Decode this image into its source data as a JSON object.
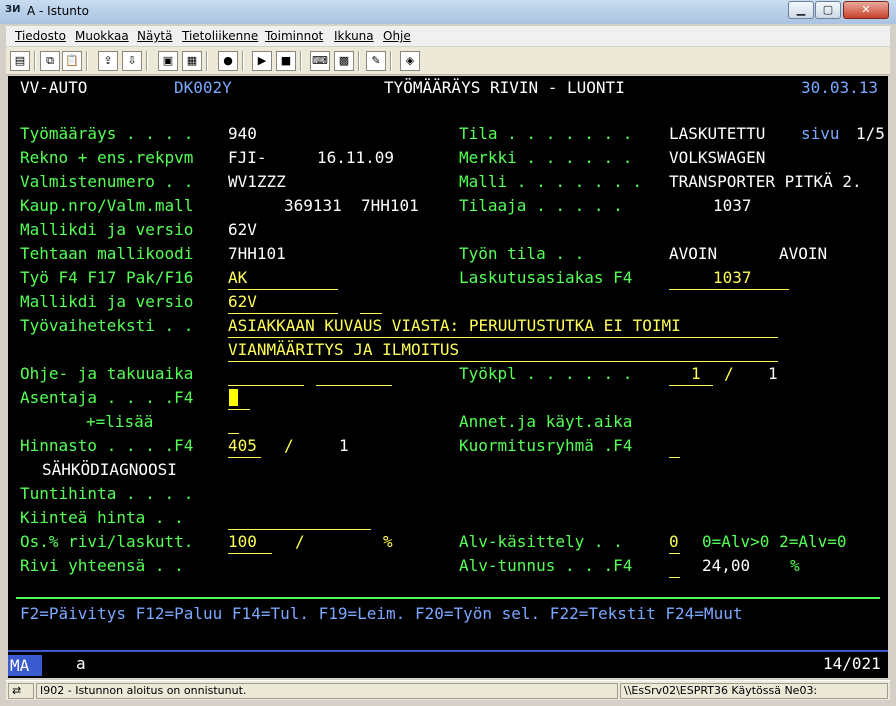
{
  "window": {
    "app_icon": "ЗИ",
    "title": "A - Istunto"
  },
  "menu": [
    "Tiedosto",
    "Muokkaa",
    "Näytä",
    "Tietoliikenne",
    "Toiminnot",
    "Ikkuna",
    "Ohje"
  ],
  "toolbar_icons": [
    "print-icon",
    "copy-icon",
    "paste-icon",
    "send-icon",
    "receive-icon",
    "display-icon",
    "macro-icon",
    "record-icon",
    "play-icon",
    "stop-icon",
    "keyboard-icon",
    "map-icon",
    "clipboard-icon",
    "eraser-icon"
  ],
  "header": {
    "company": "VV-AUTO",
    "program": "DK002Y",
    "title": "TYÖMÄÄRÄYS RIVIN - LUONTI",
    "date": "30.03.13"
  },
  "fields": {
    "tyomaarays_label": "Työmääräys . . . .",
    "tyomaarays_value": "940",
    "tila_label": "Tila . . . . . . .",
    "tila_value": "LASKUTETTU",
    "sivu_label": "sivu",
    "sivu_value": "1/5",
    "rekno_label": "Rekno + ens.rekpvm",
    "rekno_value": "FJI-",
    "rekpvm_value": "16.11.09",
    "merkki_label": "Merkki . . . . . .",
    "merkki_value": "VOLKSWAGEN",
    "valmistenumero_label": "Valmistenumero . .",
    "valmistenumero_value": "WV1ZZZ",
    "malli_label": "Malli . . . . . . .",
    "malli_value": "TRANSPORTER PITKÄ 2.",
    "kaup_label": "Kaup.nro/Valm.mall",
    "kaup_nro": "369131",
    "valm_mall": "7HH101",
    "tilaaja_label": "Tilaaja . . . . .",
    "tilaaja_value": "1037",
    "mallikdi1_label": "Mallikdi ja versio",
    "mallikdi1_value": "62V",
    "tehtaan_label": "Tehtaan mallikoodi",
    "tehtaan_value": "7HH101",
    "tyon_tila_label": "Työn tila . .",
    "tyon_tila_value1": "AVOIN",
    "tyon_tila_value2": "AVOIN",
    "tyo_f4_label": "Työ F4 F17 Pak/F16",
    "tyo_f4_value": "AK",
    "laskutusasiakas_label": "Laskutusasiakas F4",
    "laskutusasiakas_value": "1037",
    "mallikdi2_label": "Mallikdi ja versio",
    "mallikdi2_value": "62V",
    "tyovaiheteksti_label": "Työvaiheteksti . .",
    "tyovaiheteksti_line1": "ASIAKKAAN KUVAUS VIASTA: PERUUTUSTUTKA EI TOIMI",
    "tyovaiheteksti_line2": "VIANMÄÄRITYS JA ILMOITUS",
    "ohje_label": "Ohje- ja takuuaika",
    "tyokpl_label": "Työkpl . . . . . .",
    "tyokpl_value": "1",
    "tyokpl_slash": "/",
    "tyokpl_total": "1",
    "asentaja_label": "Asentaja . . . .F4",
    "lisaa_label": "+=lisää",
    "annet_label": "Annet.ja käyt.aika",
    "hinnasto_label": "Hinnasto . . . .F4",
    "hinnasto_value": "405",
    "hinnasto_slash": "/",
    "hinnasto_num": "1",
    "kuormitus_label": "Kuormitusryhmä .F4",
    "hinnasto_name": "SÄHKÖDIAGNOOSI",
    "tuntihinta_label": "Tuntihinta . . . .",
    "kiintea_label": "Kiinteä hinta . .",
    "os_label": "Os.% rivi/laskutt.",
    "os_value": "100",
    "os_slash": "/",
    "os_pct": "%",
    "alv_kasittely_label": "Alv-käsittely . .",
    "alv_kasittely_value": "0",
    "alv_kasittely_hint": "0=Alv>0 2=Alv=0",
    "rivi_label": "Rivi yhteensä . .",
    "alv_tunnus_label": "Alv-tunnus . . .F4",
    "alv_tunnus_value": "24,00",
    "alv_tunnus_pct": "%"
  },
  "function_keys": "F2=Päivitys F12=Paluu F14=Tul. F19=Leim. F20=Työn sel. F22=Tekstit F24=Muut",
  "status_line": {
    "mode": "MA",
    "indicator": "a",
    "position": "14/021"
  },
  "statusbar": {
    "message": "I902 - Istunnon aloitus on onnistunut.",
    "connection": "\\\\EsSrv02\\ESPRT36 Käytössä Ne03:"
  },
  "colors": {
    "background": "#000000",
    "field": "#55ff55",
    "header": "#7aa8ff",
    "input": "#ffff55",
    "text": "#ffffff"
  }
}
